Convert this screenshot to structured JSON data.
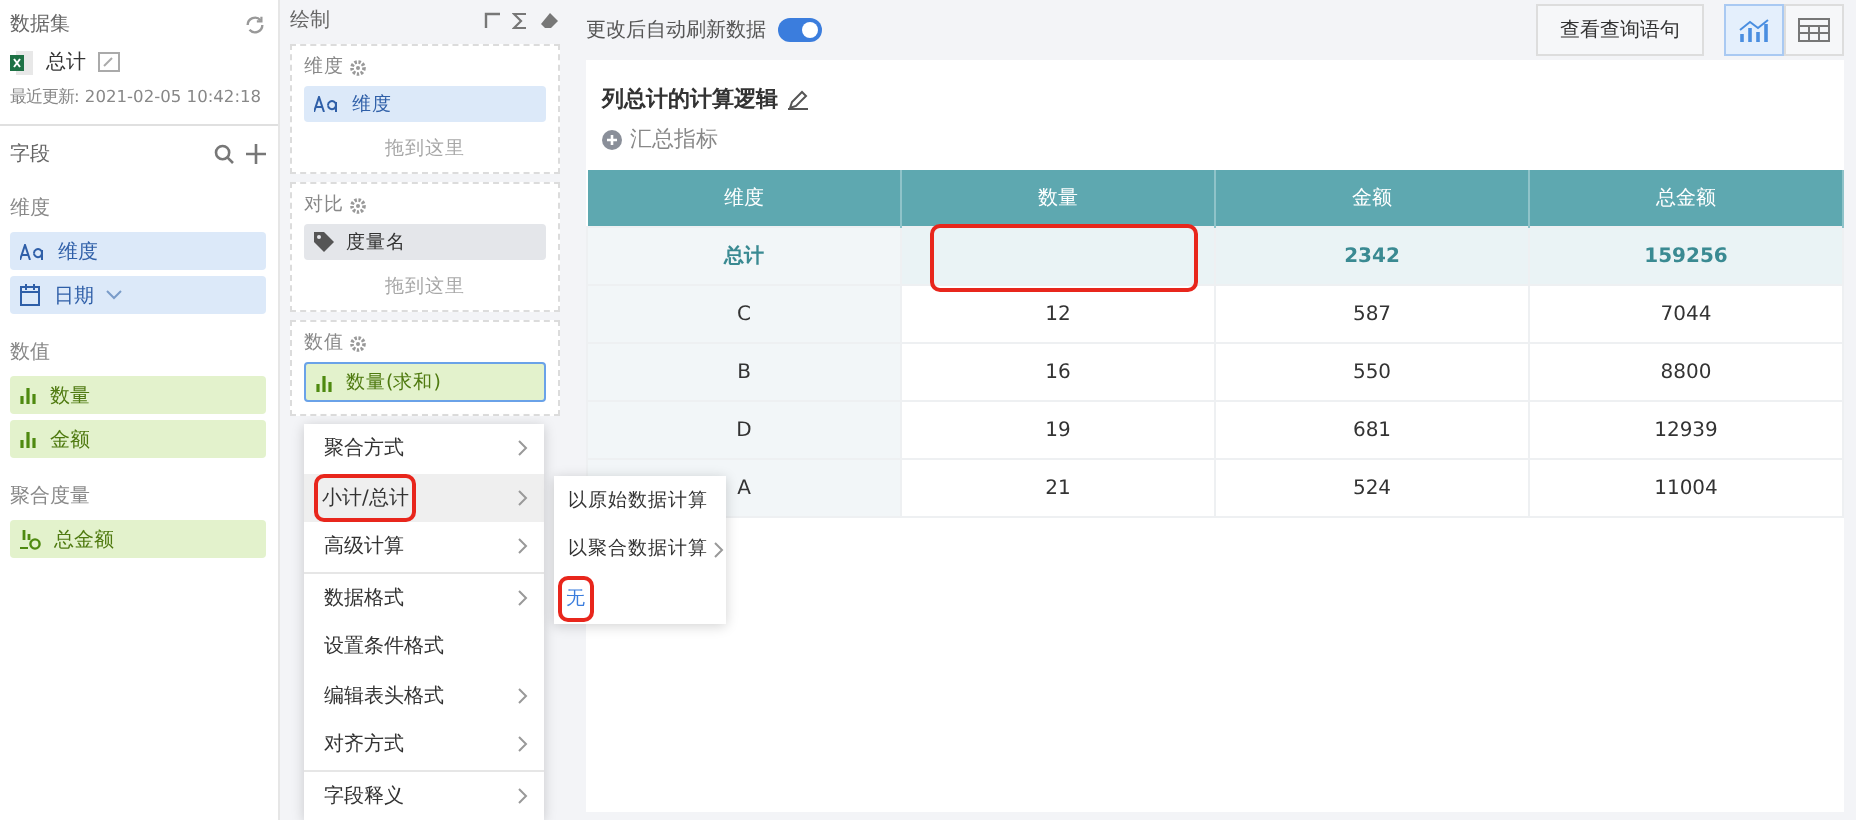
{
  "dataset": {
    "heading": "数据集",
    "name": "总计",
    "updated": "最近更新: 2021-02-05 10:42:18"
  },
  "fields": {
    "heading": "字段",
    "groups": [
      {
        "label": "维度",
        "items": [
          {
            "name": "维度",
            "kind": "text"
          },
          {
            "name": "日期",
            "kind": "date"
          }
        ]
      },
      {
        "label": "数值",
        "items": [
          {
            "name": "数量",
            "kind": "measure"
          },
          {
            "name": "金额",
            "kind": "measure"
          }
        ]
      },
      {
        "label": "聚合度量",
        "items": [
          {
            "name": "总金额",
            "kind": "aggregate"
          }
        ]
      }
    ]
  },
  "draw": {
    "heading": "绘制",
    "sections": [
      {
        "label": "维度",
        "items": [
          {
            "name": "维度",
            "kind": "text"
          }
        ],
        "drop_hint": "拖到这里"
      },
      {
        "label": "对比",
        "items": [
          {
            "name": "度量名",
            "kind": "tag"
          }
        ],
        "drop_hint": "拖到这里"
      },
      {
        "label": "数值",
        "items": [
          {
            "name": "数量(求和)",
            "kind": "measure"
          }
        ]
      }
    ]
  },
  "menu": {
    "groups": [
      [
        {
          "label": "聚合方式",
          "has_submenu": true,
          "selected": false,
          "highlighted": false
        },
        {
          "label": "小计/总计",
          "has_submenu": true,
          "selected": true,
          "highlighted": true
        },
        {
          "label": "高级计算",
          "has_submenu": true,
          "selected": false,
          "highlighted": false
        }
      ],
      [
        {
          "label": "数据格式",
          "has_submenu": true,
          "selected": false,
          "highlighted": false
        },
        {
          "label": "设置条件格式",
          "has_submenu": false,
          "selected": false,
          "highlighted": false
        },
        {
          "label": "编辑表头格式",
          "has_submenu": true,
          "selected": false,
          "highlighted": false
        },
        {
          "label": "对齐方式",
          "has_submenu": true,
          "selected": false,
          "highlighted": false
        }
      ],
      [
        {
          "label": "字段释义",
          "has_submenu": true,
          "selected": false,
          "highlighted": false
        }
      ]
    ]
  },
  "submenu": [
    {
      "label": "以原始数据计算",
      "has_submenu": false,
      "selected": false,
      "highlighted": false
    },
    {
      "label": "以聚合数据计算",
      "has_submenu": true,
      "selected": false,
      "highlighted": false
    },
    {
      "label": "无",
      "has_submenu": false,
      "selected": true,
      "highlighted": true
    }
  ],
  "toolbar": {
    "auto_refresh_label": "更改后自动刷新数据",
    "auto_refresh_on": true,
    "query_button": "查看查询语句",
    "views": [
      {
        "kind": "chart",
        "selected": true
      },
      {
        "kind": "table",
        "selected": false
      }
    ]
  },
  "chart_title": "列总计的计算逻辑",
  "add_metric": "汇总指标",
  "table": {
    "columns": [
      "维度",
      "数量",
      "金额",
      "总金额"
    ],
    "total_row": [
      {
        "text": "总计",
        "highlighted": false
      },
      {
        "highlighted": true
      },
      {
        "text": "2342",
        "highlighted": false
      },
      {
        "text": "159256",
        "highlighted": false
      }
    ],
    "rows": [
      [
        "C",
        "12",
        "587",
        "7044"
      ],
      [
        "B",
        "16",
        "550",
        "8800"
      ],
      [
        "D",
        "19",
        "681",
        "12939"
      ],
      [
        "A",
        "21",
        "524",
        "11004"
      ]
    ]
  }
}
